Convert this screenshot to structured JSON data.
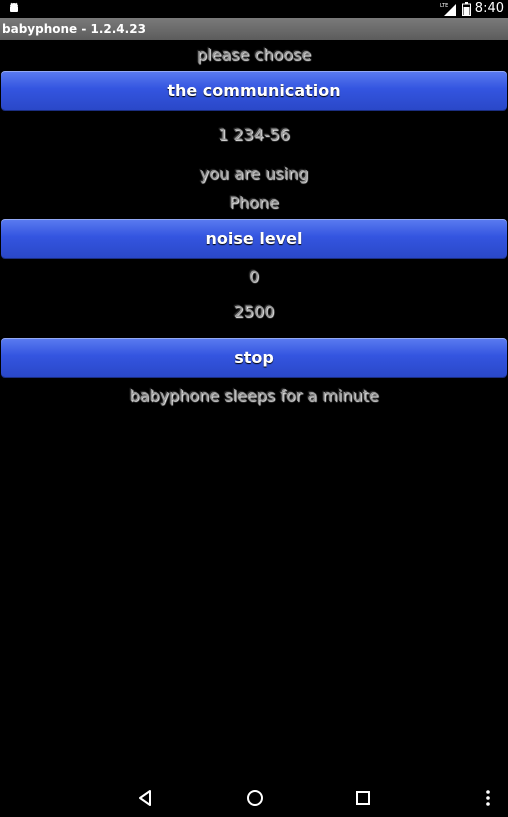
{
  "status_bar": {
    "time": "8:40",
    "network_label": "LTE",
    "icons": [
      "android-icon",
      "signal-icon",
      "battery-icon"
    ]
  },
  "app": {
    "title": "babyphone - 1.2.4.23"
  },
  "main": {
    "choose_label": "please choose",
    "communication_button": "the communication",
    "phone_number": "1 234-56",
    "using_label": "you are using",
    "using_value": "Phone",
    "noise_button": "noise level",
    "noise_current": "0",
    "noise_threshold": "2500",
    "stop_button": "stop",
    "status_message": "babyphone sleeps for a minute"
  },
  "navigation": {
    "icons": [
      "back-icon",
      "home-icon",
      "recents-icon",
      "overflow-menu-icon"
    ]
  },
  "colors": {
    "button_blue": "#3455e0",
    "text_gray": "#9a9a9a",
    "background": "#000000",
    "title_bar": "#6a6a6a"
  }
}
